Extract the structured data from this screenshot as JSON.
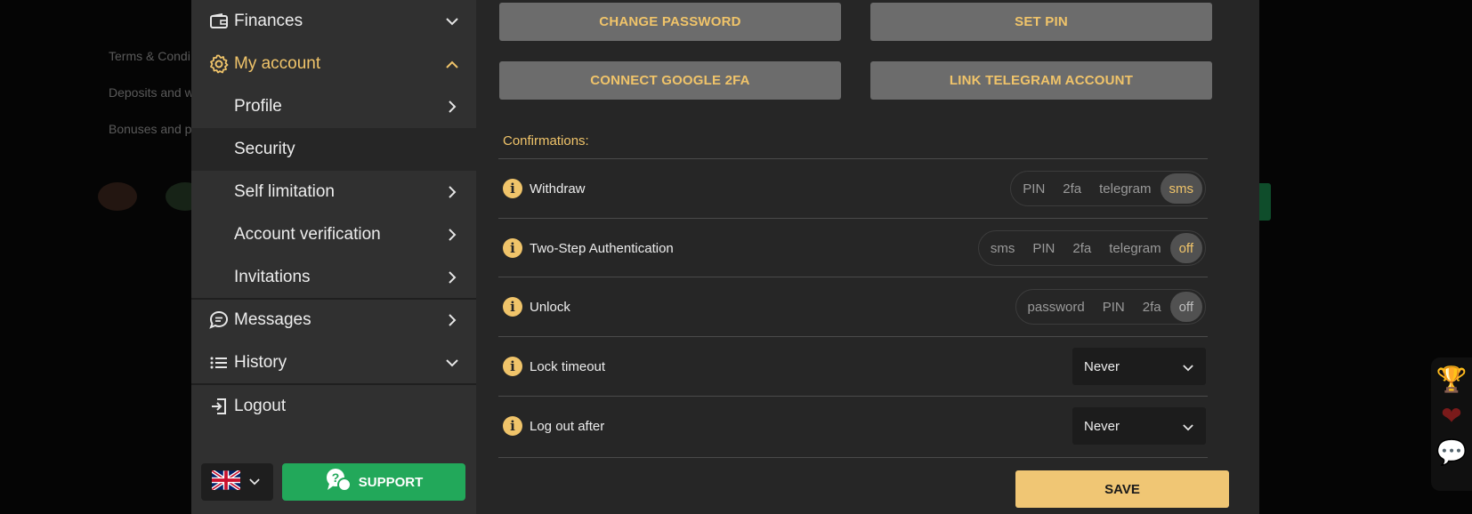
{
  "background": {
    "links": [
      "Terms & Condi",
      "Deposits and w",
      "Bonuses and p"
    ]
  },
  "sidebar": {
    "items": [
      {
        "label": "Finances",
        "icon": "wallet-icon",
        "chevron": "down"
      },
      {
        "label": "My account",
        "icon": "gear-icon",
        "chevron": "up",
        "active": true
      },
      {
        "label": "Profile",
        "chevron": "right"
      },
      {
        "label": "Security",
        "selected": true
      },
      {
        "label": "Self limitation",
        "chevron": "right"
      },
      {
        "label": "Account verification",
        "chevron": "right"
      },
      {
        "label": "Invitations",
        "chevron": "right"
      },
      {
        "label": "Messages",
        "icon": "chat-icon",
        "chevron": "right"
      },
      {
        "label": "History",
        "icon": "list-icon",
        "chevron": "down"
      },
      {
        "label": "Logout",
        "icon": "logout-icon"
      }
    ],
    "language_icon": "uk-flag-icon",
    "support_label": "SUPPORT"
  },
  "security": {
    "buttons": {
      "change_password": "CHANGE PASSWORD",
      "set_pin": "SET PIN",
      "connect_2fa": "CONNECT GOOGLE 2FA",
      "link_telegram": "LINK TELEGRAM ACCOUNT"
    },
    "confirmations_title": "Confirmations:",
    "rows": {
      "withdraw": {
        "label": "Withdraw",
        "options": [
          "PIN",
          "2fa",
          "telegram",
          "sms"
        ],
        "selected": "sms"
      },
      "two_step": {
        "label": "Two-Step Authentication",
        "options": [
          "sms",
          "PIN",
          "2fa",
          "telegram",
          "off"
        ],
        "selected": "off"
      },
      "unlock": {
        "label": "Unlock",
        "options": [
          "password",
          "PIN",
          "2fa",
          "off"
        ],
        "selected": "off"
      },
      "lock_timeout": {
        "label": "Lock timeout",
        "value": "Never"
      },
      "logout_after": {
        "label": "Log out after",
        "value": "Never"
      }
    },
    "save_label": "SAVE"
  },
  "colors": {
    "accent": "#f0c46a",
    "support": "#22a85a",
    "sidebar": "#303030",
    "panel": "#262626"
  }
}
